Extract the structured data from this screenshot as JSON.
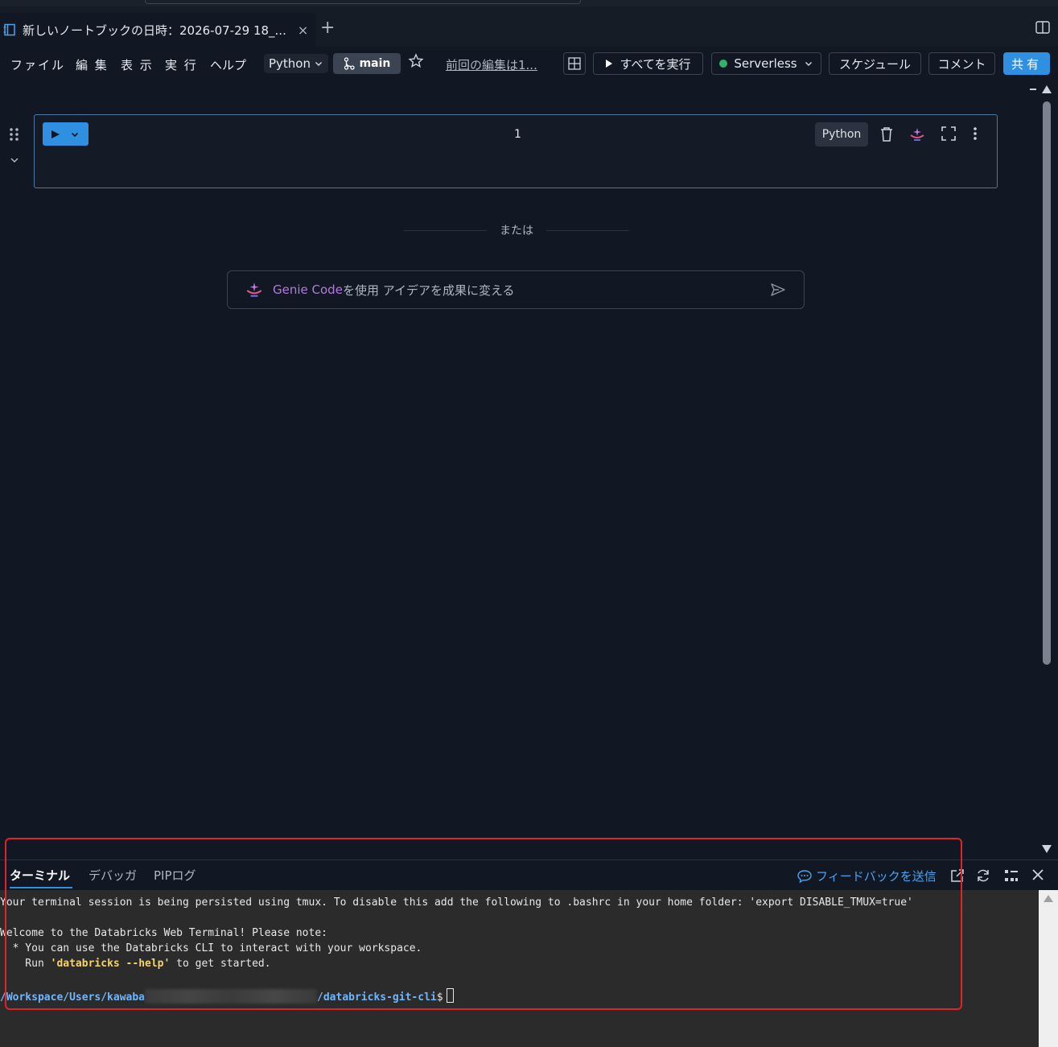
{
  "tab": {
    "title": "新しいノートブックの日時：2026-07-29 18_...",
    "close_glyph": "×",
    "add_glyph": "+"
  },
  "menu": {
    "file": "ファイル",
    "edit": "編 集",
    "view": "表 示",
    "run": "実 行",
    "help": "ヘルプ"
  },
  "toolbar": {
    "language": "Python",
    "branch": "main",
    "last_edit": "前回の編集は1...",
    "run_all": "すべてを実行",
    "compute": "Serverless",
    "schedule": "スケジュール",
    "comment": "コメント",
    "share": "共有"
  },
  "cell": {
    "line_number": "1",
    "language": "Python"
  },
  "separator": {
    "text": "または"
  },
  "genie": {
    "name": "Genie Code",
    "rest": "を使用 アイデアを成果に変える"
  },
  "bottom_panel": {
    "tabs": [
      "ターミナル",
      "デバッガ",
      "PIPログ"
    ],
    "feedback": "フィードバックを送信"
  },
  "terminal": {
    "line1": "Your terminal session is being persisted using tmux. To disable this add the following to .bashrc in your home folder: 'export DISABLE_TMUX=true'",
    "line2": "Welcome to the Databricks Web Terminal! Please note:",
    "line3": "  * You can use the Databricks CLI to interact with your workspace.",
    "line4_pre": "    Run ",
    "line4_cmd": "'databricks --help'",
    "line4_post": " to get started.",
    "prompt_path_start": "/Workspace/Users/kawaba",
    "prompt_path_end": "/databricks-git-cli",
    "prompt_symbol": "$"
  },
  "colors": {
    "accent": "#2f8fe0",
    "background": "#111824",
    "terminal_bg": "#2b2b2b",
    "highlight": "#e0222a",
    "genie": "#b57ad9",
    "online": "#2fb36b"
  }
}
